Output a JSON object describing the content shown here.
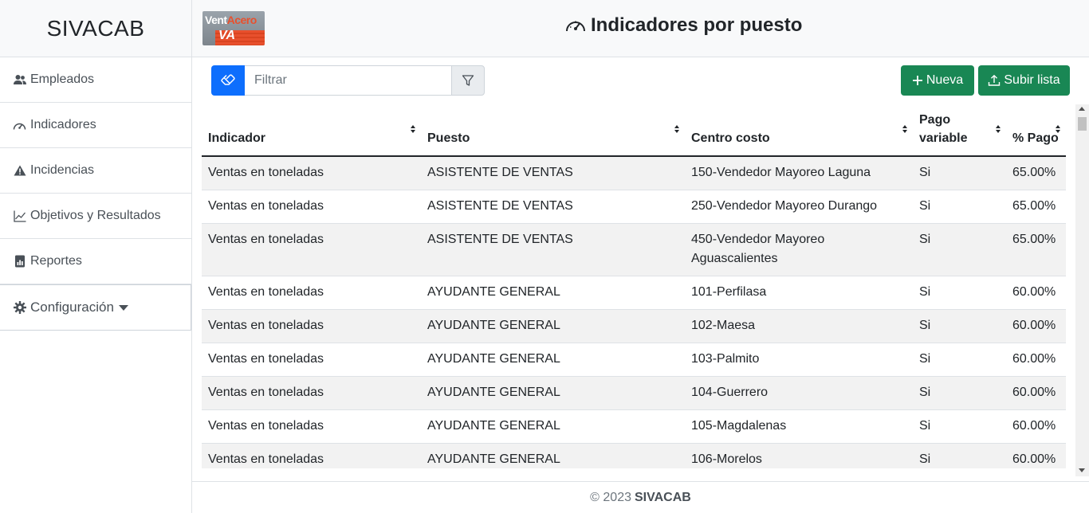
{
  "brand": "SIVACAB",
  "logo": {
    "prefix": "Vent",
    "accent": "Acero",
    "mark": "VA"
  },
  "header": {
    "title": "Indicadores por puesto"
  },
  "sidebar": {
    "items": [
      {
        "label": "Empleados",
        "icon": "people-icon"
      },
      {
        "label": "Indicadores",
        "icon": "speedometer-icon"
      },
      {
        "label": "Incidencias",
        "icon": "warning-icon"
      },
      {
        "label": "Objetivos y Resultados",
        "icon": "graph-icon"
      },
      {
        "label": "Reportes",
        "icon": "report-icon"
      },
      {
        "label": "Configuración",
        "icon": "gear-icon"
      }
    ]
  },
  "filter": {
    "placeholder": "Filtrar",
    "value": ""
  },
  "actions": {
    "new_label": "Nueva",
    "upload_label": "Subir lista"
  },
  "table": {
    "headers": [
      "Indicador",
      "Puesto",
      "Centro costo",
      "Pago variable",
      "% Pago"
    ],
    "rows": [
      [
        "Ventas en toneladas",
        "ASISTENTE DE VENTAS",
        "150-Vendedor Mayoreo Laguna",
        "Si",
        "65.00%"
      ],
      [
        "Ventas en toneladas",
        "ASISTENTE DE VENTAS",
        "250-Vendedor Mayoreo Durango",
        "Si",
        "65.00%"
      ],
      [
        "Ventas en toneladas",
        "ASISTENTE DE VENTAS",
        "450-Vendedor Mayoreo Aguascalientes",
        "Si",
        "65.00%"
      ],
      [
        "Ventas en toneladas",
        "AYUDANTE GENERAL",
        "101-Perfilasa",
        "Si",
        "60.00%"
      ],
      [
        "Ventas en toneladas",
        "AYUDANTE GENERAL",
        "102-Maesa",
        "Si",
        "60.00%"
      ],
      [
        "Ventas en toneladas",
        "AYUDANTE GENERAL",
        "103-Palmito",
        "Si",
        "60.00%"
      ],
      [
        "Ventas en toneladas",
        "AYUDANTE GENERAL",
        "104-Guerrero",
        "Si",
        "60.00%"
      ],
      [
        "Ventas en toneladas",
        "AYUDANTE GENERAL",
        "105-Magdalenas",
        "Si",
        "60.00%"
      ],
      [
        "Ventas en toneladas",
        "AYUDANTE GENERAL",
        "106-Morelos",
        "Si",
        "60.00%"
      ]
    ]
  },
  "footer": {
    "copyright": "© 2023",
    "name": "SIVACAB"
  },
  "colors": {
    "primary": "#0d6efd",
    "success": "#198754",
    "accent": "#e8502d"
  }
}
